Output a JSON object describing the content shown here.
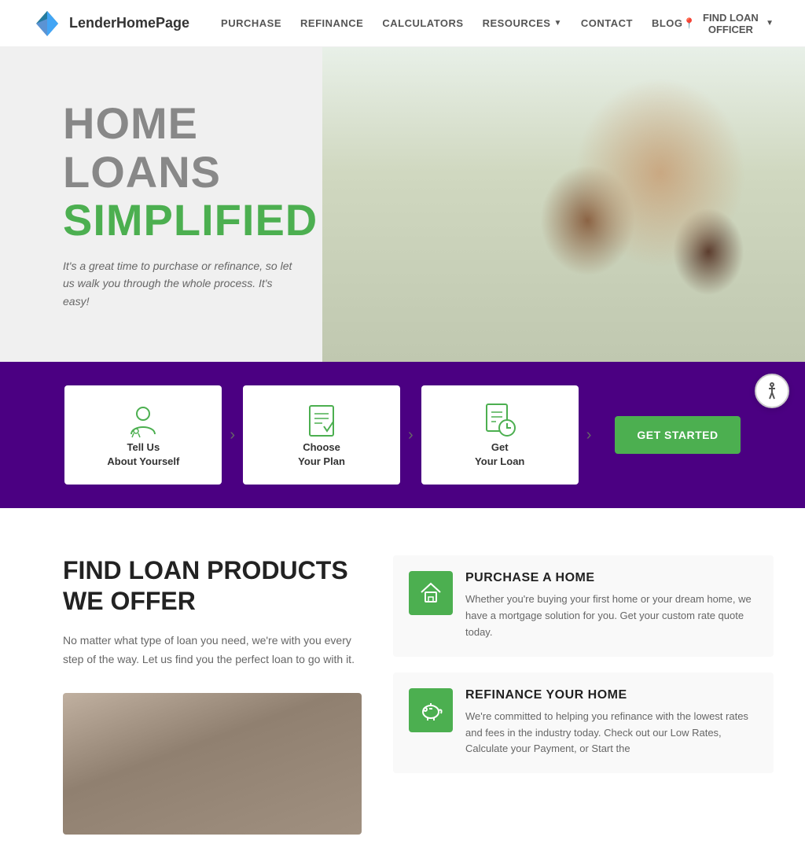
{
  "header": {
    "logo_text": "LenderHomePage",
    "nav": {
      "items": [
        {
          "label": "PURCHASE",
          "href": "#"
        },
        {
          "label": "REFINANCE",
          "href": "#"
        },
        {
          "label": "CALCULATORS",
          "href": "#"
        },
        {
          "label": "RESOURCES",
          "href": "#",
          "has_dropdown": true
        },
        {
          "label": "CONTACT",
          "href": "#"
        },
        {
          "label": "BLOG",
          "href": "#"
        }
      ],
      "find_loan": "FIND LOAN OFFICER"
    }
  },
  "hero": {
    "line1": "HOME",
    "line2": "LOANS",
    "line3": "SIMPLIFIED",
    "subtitle": "It's a great time to purchase or refinance, so let us walk you through the whole process. It's easy!"
  },
  "steps": {
    "items": [
      {
        "label": "Tell Us\nAbout Yourself",
        "icon": "person-icon"
      },
      {
        "label": "Choose\nYour Plan",
        "icon": "document-check-icon"
      },
      {
        "label": "Get\nYour Loan",
        "icon": "document-clock-icon"
      }
    ],
    "cta_label": "GET STARTED"
  },
  "loan_section": {
    "title": "FIND LOAN PRODUCTS\nWE OFFER",
    "description": "No matter what type of loan you need, we're with you every step of the way. Let us find you the perfect loan to go with it.",
    "products": [
      {
        "icon": "home-icon",
        "title": "PURCHASE A HOME",
        "description": "Whether you're buying your first home or your dream home, we have a mortgage solution for you. Get your custom rate quote today."
      },
      {
        "icon": "piggy-bank-icon",
        "title": "REFINANCE YOUR HOME",
        "description": "We're committed to helping you refinance with the lowest rates and fees in the industry today. Check out our Low Rates, Calculate your Payment, or Start the"
      }
    ]
  },
  "accessibility": {
    "label": "Accessibility"
  }
}
